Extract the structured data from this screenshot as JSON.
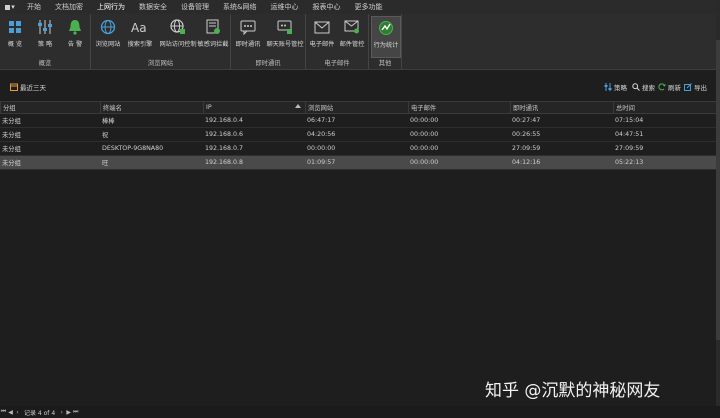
{
  "menu": {
    "app_button": "▾",
    "items": [
      "开始",
      "文档加密",
      "上网行为",
      "数据安全",
      "设备管理",
      "系统&网络",
      "运维中心",
      "报表中心",
      "更多功能"
    ],
    "active_index": 2
  },
  "ribbon": {
    "groups": [
      {
        "label": "概览",
        "buttons": [
          {
            "label": "概 览",
            "icon": "grid-icon"
          },
          {
            "label": "策 略",
            "icon": "sliders-icon"
          },
          {
            "label": "告 警",
            "icon": "bell-icon"
          }
        ]
      },
      {
        "label": "浏览网站",
        "buttons": [
          {
            "label": "浏览网站",
            "icon": "globe-icon"
          },
          {
            "label": "搜索引擎",
            "icon": "font-icon"
          },
          {
            "label": "网站访问控制",
            "icon": "globe-lock-icon"
          },
          {
            "label": "敏感词拦截",
            "icon": "filter-icon"
          }
        ]
      },
      {
        "label": "即时通讯",
        "buttons": [
          {
            "label": "即时通讯",
            "icon": "chat-icon"
          },
          {
            "label": "聊天账号管控",
            "icon": "chat-control-icon"
          }
        ]
      },
      {
        "label": "电子邮件",
        "buttons": [
          {
            "label": "电子邮件",
            "icon": "mail-icon"
          },
          {
            "label": "邮件管控",
            "icon": "mail-control-icon"
          }
        ]
      },
      {
        "label": "其他",
        "buttons": [
          {
            "label": "行为统计",
            "icon": "stats-icon"
          }
        ]
      }
    ],
    "selected_button": "行为统计"
  },
  "toolbar": {
    "range": "最近三天",
    "strategy": "策略",
    "search": "搜索",
    "refresh": "刷新",
    "export": "导出"
  },
  "table": {
    "columns": [
      "分组",
      "终端名",
      "IP",
      "浏览网站",
      "电子邮件",
      "即时通讯",
      "总时间"
    ],
    "sort_column": "IP",
    "rows": [
      [
        "未分组",
        "棒棒",
        "192.168.0.4",
        "06:47:17",
        "00:00:00",
        "00:27:47",
        "07:15:04"
      ],
      [
        "未分组",
        "祝",
        "192.168.0.6",
        "04:20:56",
        "00:00:00",
        "00:26:55",
        "04:47:51"
      ],
      [
        "未分组",
        "DESKTOP-9G8NA80",
        "192.168.0.7",
        "00:00:00",
        "00:00:00",
        "27:09:59",
        "27:09:59"
      ],
      [
        "未分组",
        "旺",
        "192.168.0.8",
        "01:09:57",
        "00:00:00",
        "04:12:16",
        "05:22:13"
      ]
    ],
    "selected_row": 3
  },
  "status": {
    "record_text": "记录 4 of 4"
  },
  "watermark": "知乎 @沉默的神秘网友",
  "colors": {
    "accent_green": "#4caf50",
    "accent_blue": "#4a9fd8",
    "selected_row": "#4a4a4a"
  }
}
